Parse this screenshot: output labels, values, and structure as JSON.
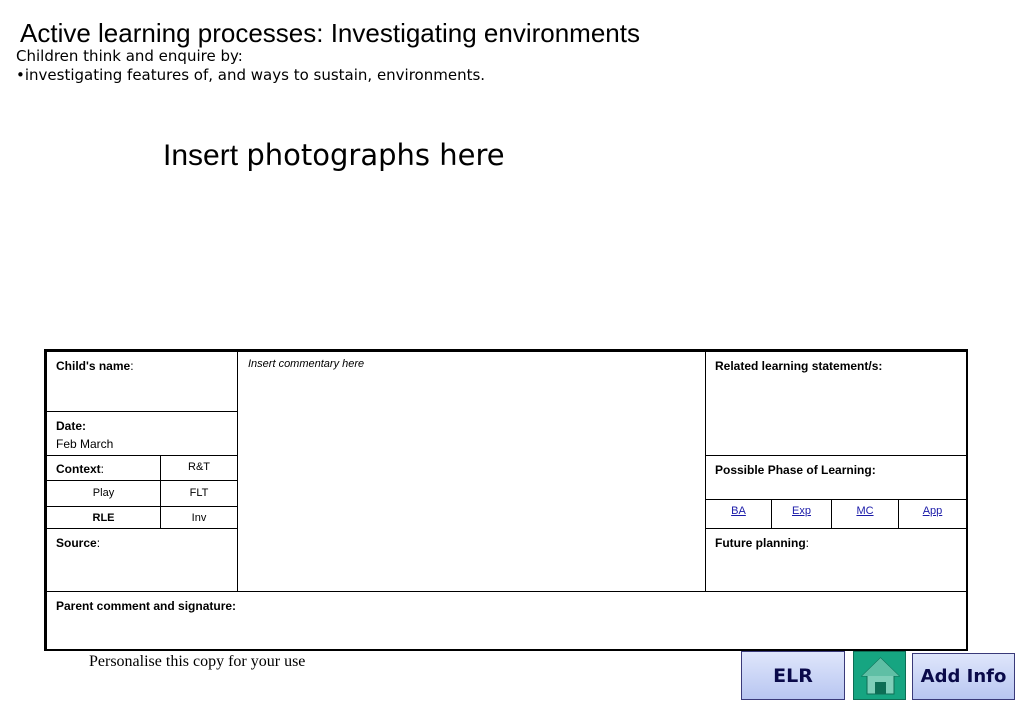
{
  "header": {
    "title": "Active learning processes: Investigating environments",
    "subtitle_line1": "Children think and enquire by:",
    "subtitle_line2": "•investigating features of, and ways to sustain, environments."
  },
  "photo_placeholder": {
    "word1": "Insert",
    "word2": "photographs here"
  },
  "form": {
    "childs_name_label": "Child's name",
    "colon": ":",
    "commentary_placeholder": "Insert commentary here",
    "related_label": "Related  learning statement/s:",
    "date_label": "Date:",
    "date_value": "Feb March",
    "context_label": "Context",
    "context_codes": [
      "R&T",
      "Play",
      "FLT",
      "RLE",
      "Inv"
    ],
    "possible_phase_label": "Possible Phase of Learning:",
    "phases": [
      "BA",
      "Exp",
      "MC",
      "App"
    ],
    "source_label": "Source",
    "future_planning_label": "Future planning",
    "parent_label": "Parent comment and signature:"
  },
  "footer": {
    "personalise": "Personalise this copy for your use",
    "elr_button": "ELR",
    "add_info_button": "Add Info",
    "home_icon": "home-icon"
  }
}
